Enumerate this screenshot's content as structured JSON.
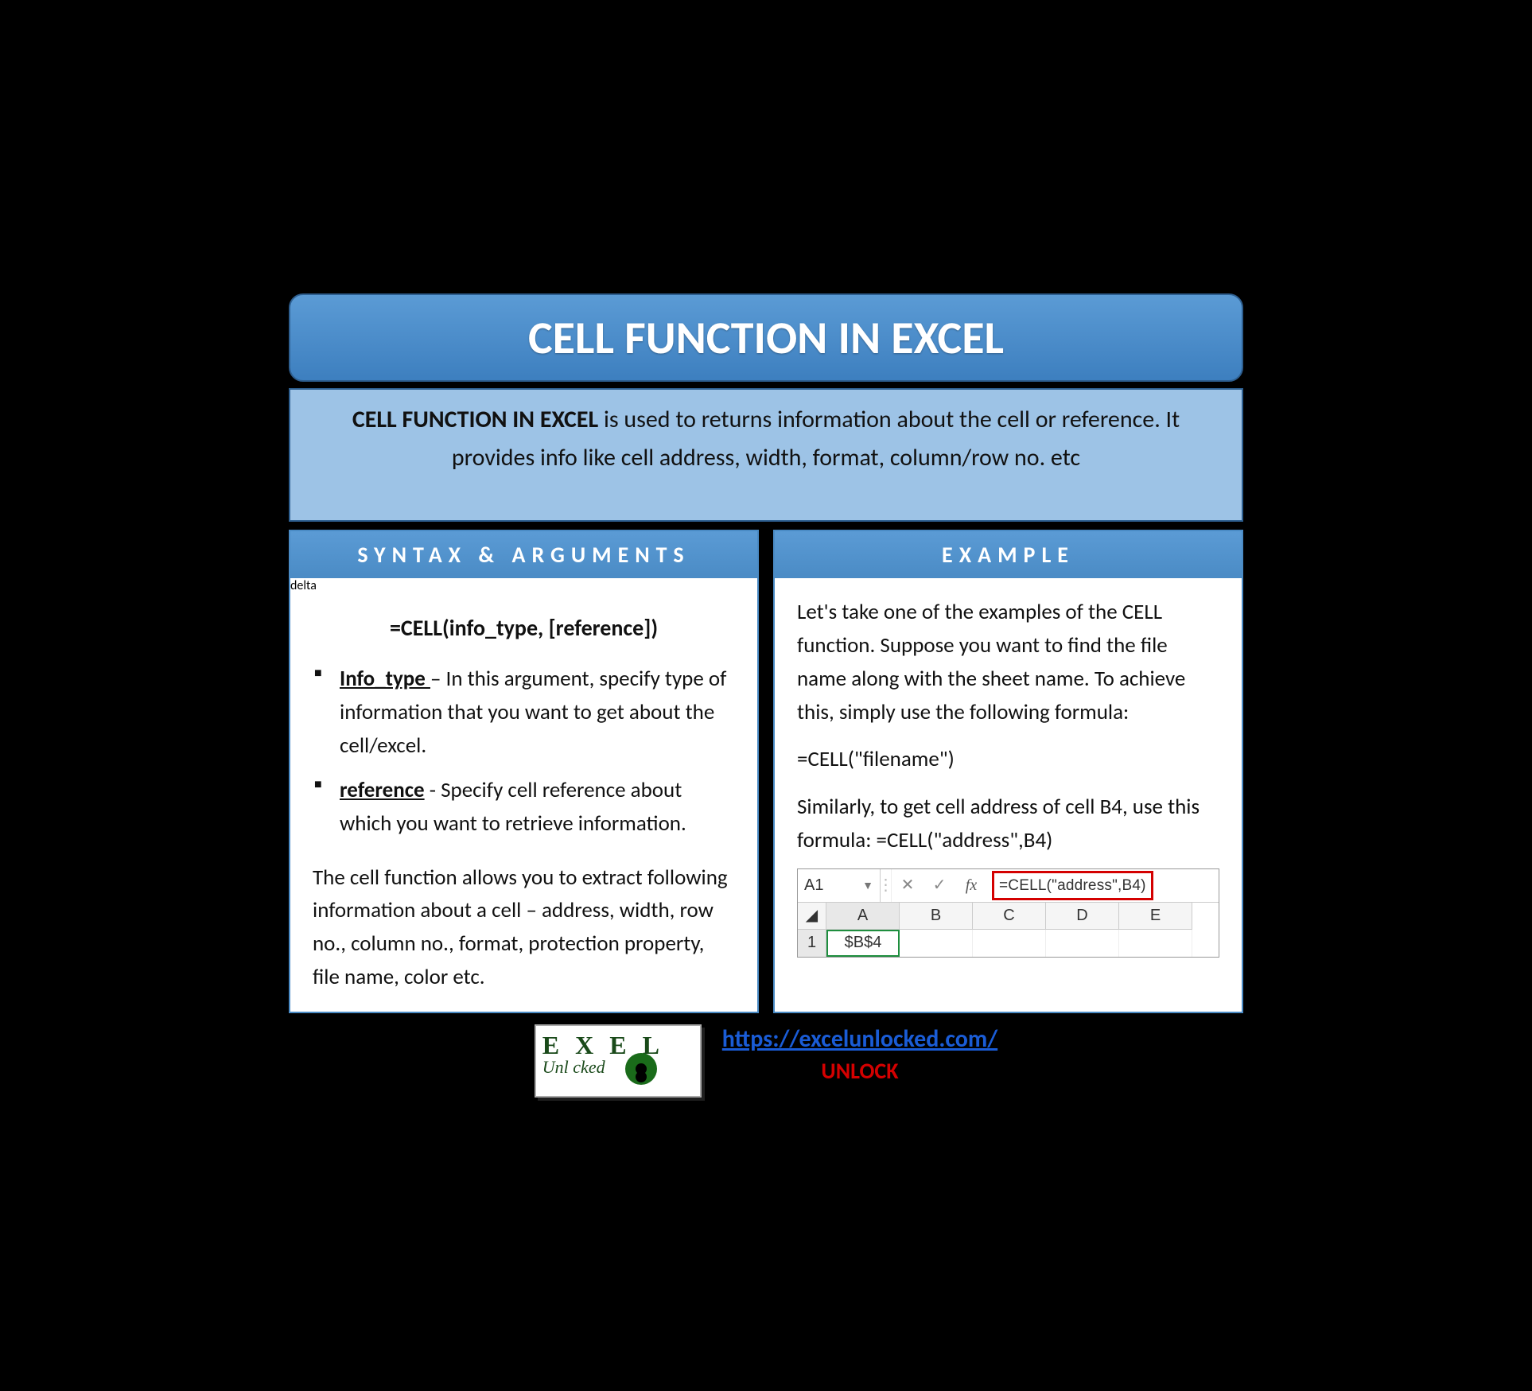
{
  "title": "CELL FUNCTION IN EXCEL",
  "description": {
    "bold_lead": "CELL FUNCTION IN EXCEL",
    "rest": " is used to returns information about the cell or reference. It provides info like cell address, width, format, column/row no. etc"
  },
  "left": {
    "header": "SYNTAX & ARGUMENTS",
    "syntax": "=CELL(info_type, [reference])",
    "args": [
      {
        "name": "Info_type ",
        "text": "– In this argument, specify type of information that you want to get about the cell/excel."
      },
      {
        "name": "reference",
        "text": " - Specify cell reference about which you want to retrieve information."
      }
    ],
    "paragraph": "The cell function allows you to extract following information about a cell – address, width, row no., column no., format, protection property, file name, color etc."
  },
  "right": {
    "header": "EXAMPLE",
    "intro": "Let's take one of the examples of the CELL function. Suppose you want to find the file name along with the sheet name. To achieve this, simply use the following formula:",
    "formula1": "=CELL(\"filename\")",
    "para2": "Similarly, to get cell address of cell B4, use this formula: =CELL(\"address\",B4)",
    "excel": {
      "namebox": "A1",
      "fx_label": "fx",
      "formula_bar": "=CELL(\"address\",B4)",
      "cols": [
        "A",
        "B",
        "C",
        "D",
        "E"
      ],
      "row_num": "1",
      "a1_value": "$B$4"
    }
  },
  "footer": {
    "logo_line1": "E X   E L",
    "logo_line2": "Unl   cked",
    "url": "https://excelunlocked.com/",
    "unlock": "UNLOCK"
  }
}
